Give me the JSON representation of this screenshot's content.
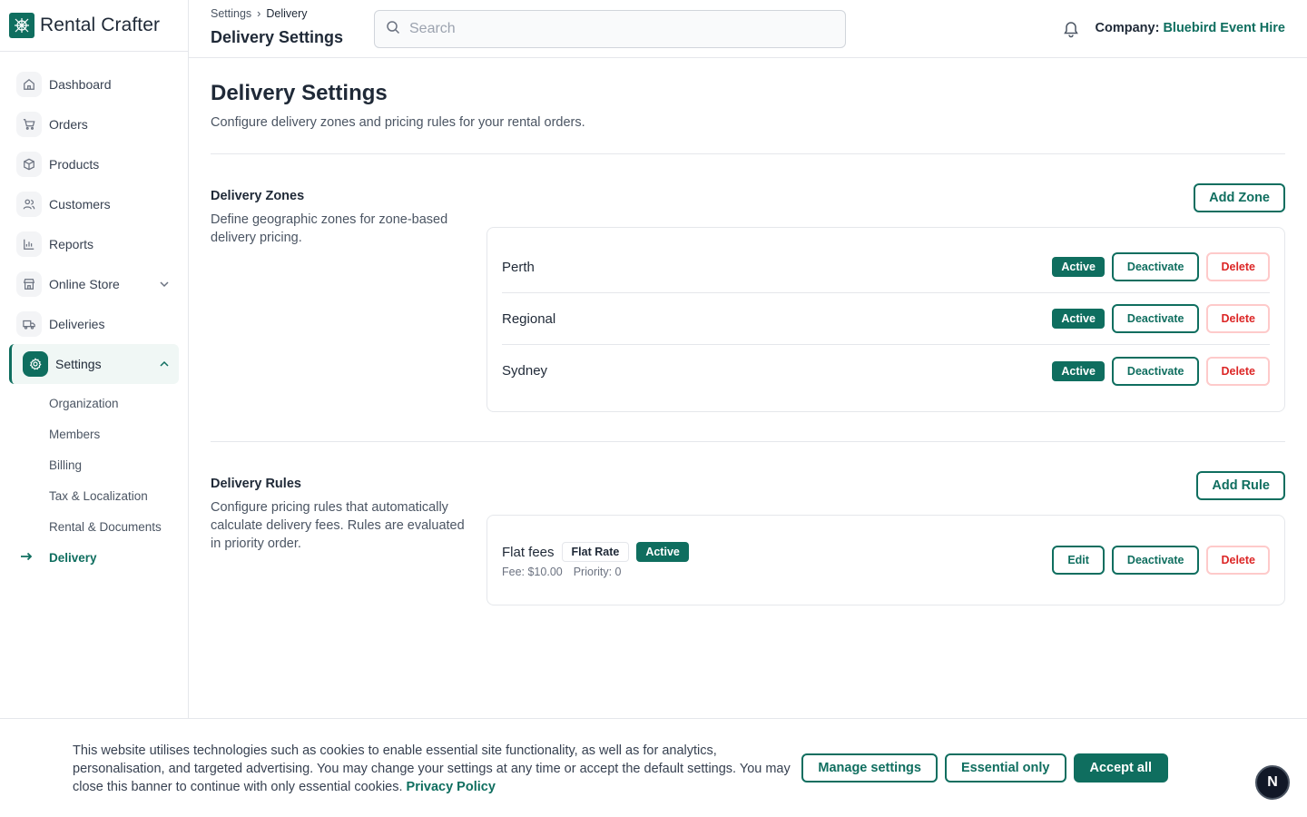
{
  "app": {
    "name": "Rental Crafter"
  },
  "sidebar": {
    "items": [
      {
        "label": "Dashboard",
        "icon": "home-icon"
      },
      {
        "label": "Orders",
        "icon": "cart-icon"
      },
      {
        "label": "Products",
        "icon": "box-icon"
      },
      {
        "label": "Customers",
        "icon": "users-icon"
      },
      {
        "label": "Reports",
        "icon": "bar-chart-icon"
      },
      {
        "label": "Online Store",
        "icon": "store-icon"
      },
      {
        "label": "Deliveries",
        "icon": "truck-icon"
      },
      {
        "label": "Settings",
        "icon": "settings-icon"
      }
    ],
    "settings_sub": [
      {
        "label": "Organization"
      },
      {
        "label": "Members"
      },
      {
        "label": "Billing"
      },
      {
        "label": "Tax & Localization"
      },
      {
        "label": "Rental & Documents"
      },
      {
        "label": "Delivery"
      }
    ]
  },
  "header": {
    "breadcrumb": [
      "Settings",
      "Delivery"
    ],
    "breadcrumb_sep": "›",
    "title": "Delivery Settings",
    "search_placeholder": "Search",
    "company_label": "Company:",
    "company_name": "Bluebird Event Hire"
  },
  "page": {
    "title": "Delivery Settings",
    "description": "Configure delivery zones and pricing rules for your rental orders."
  },
  "zones": {
    "title": "Delivery Zones",
    "description": "Define geographic zones for zone-based delivery pricing.",
    "add_label": "Add Zone",
    "items": [
      {
        "name": "Perth",
        "status": "Active",
        "deactivate": "Deactivate",
        "delete": "Delete"
      },
      {
        "name": "Regional",
        "status": "Active",
        "deactivate": "Deactivate",
        "delete": "Delete"
      },
      {
        "name": "Sydney",
        "status": "Active",
        "deactivate": "Deactivate",
        "delete": "Delete"
      }
    ]
  },
  "rules": {
    "title": "Delivery Rules",
    "description": "Configure pricing rules that automatically calculate delivery fees. Rules are evaluated in priority order.",
    "add_label": "Add Rule",
    "items": [
      {
        "name": "Flat fees",
        "type": "Flat Rate",
        "status": "Active",
        "fee": "Fee: $10.00",
        "priority": "Priority: 0",
        "edit": "Edit",
        "deactivate": "Deactivate",
        "delete": "Delete"
      }
    ]
  },
  "cookie": {
    "text": "This website utilises technologies such as cookies to enable essential site functionality, as well as for analytics, personalisation, and targeted advertising. You may change your settings at any time or accept the default settings. You may close this banner to continue with only essential cookies.",
    "link": "Privacy Policy",
    "manage": "Manage settings",
    "essential": "Essential only",
    "accept": "Accept all"
  },
  "dev_badge": "N",
  "colors": {
    "accent": "#0f6e5f",
    "danger": "#dc2626",
    "danger_border": "#fecaca"
  }
}
